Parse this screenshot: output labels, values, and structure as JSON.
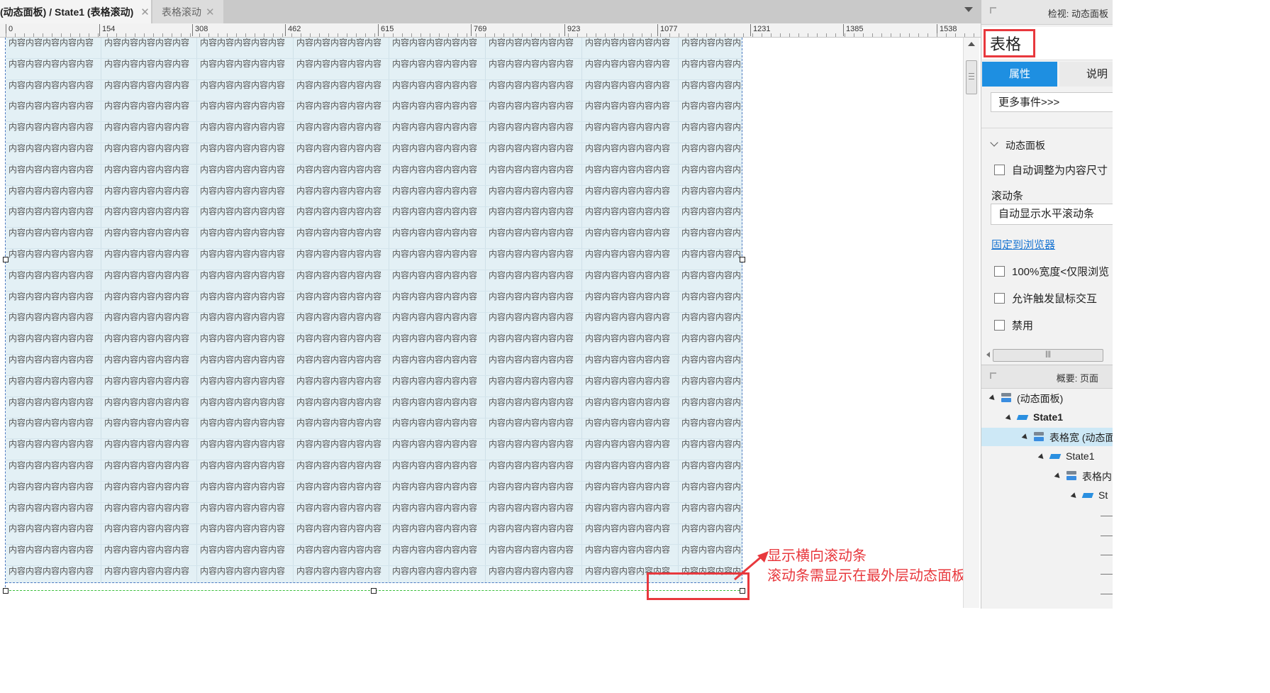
{
  "tabs": [
    {
      "label": "(动态面板) / State1 (表格滚动)",
      "active": true
    },
    {
      "label": "表格滚动",
      "active": false
    }
  ],
  "tab_close_glyph": "✕",
  "ruler": {
    "labels": [
      "0",
      "154",
      "308",
      "462",
      "615",
      "769",
      "923",
      "1077",
      "1231",
      "1385",
      "1538"
    ]
  },
  "table": {
    "cell_text": "内容内容内容内容内容",
    "visible_rows": 26,
    "visible_columns": 8,
    "cell_fill": "#e3f0f5",
    "frame_color": "#4a78c0"
  },
  "annotation": {
    "line1": "显示横向滚动条",
    "line2": "滚动条需显示在最外层动态面板的外面",
    "color": "#e8383d"
  },
  "inspector": {
    "header": "检视: 动态面板",
    "widget_name": "表格",
    "tab_properties": "属性",
    "tab_notes": "说明",
    "more_events": "更多事件>>>",
    "section_title": "动态面板",
    "auto_fit": "自动调整为内容尺寸",
    "scrollbar_label": "滚动条",
    "scrollbar_value": "自动显示水平滚动条",
    "pin_to_browser": "固定到浏览器",
    "full_width": "100%宽度<仅限浏览",
    "allow_mouse": "允许触发鼠标交互",
    "disabled": "禁用",
    "accent": "#1e8fe1"
  },
  "outline": {
    "header": "概要: 页面",
    "items": [
      {
        "label": "(动态面板)",
        "kind": "dynamic-panel",
        "depth": 0,
        "selected": false
      },
      {
        "label": "State1",
        "kind": "state",
        "depth": 1,
        "selected": false
      },
      {
        "label": "表格宽 (动态面",
        "kind": "dynamic-panel",
        "depth": 2,
        "selected": true
      },
      {
        "label": "State1",
        "kind": "state",
        "depth": 3,
        "selected": false
      },
      {
        "label": "表格内",
        "kind": "dynamic-panel",
        "depth": 4,
        "selected": false
      },
      {
        "label": "St",
        "kind": "state",
        "depth": 5,
        "selected": false
      }
    ]
  }
}
